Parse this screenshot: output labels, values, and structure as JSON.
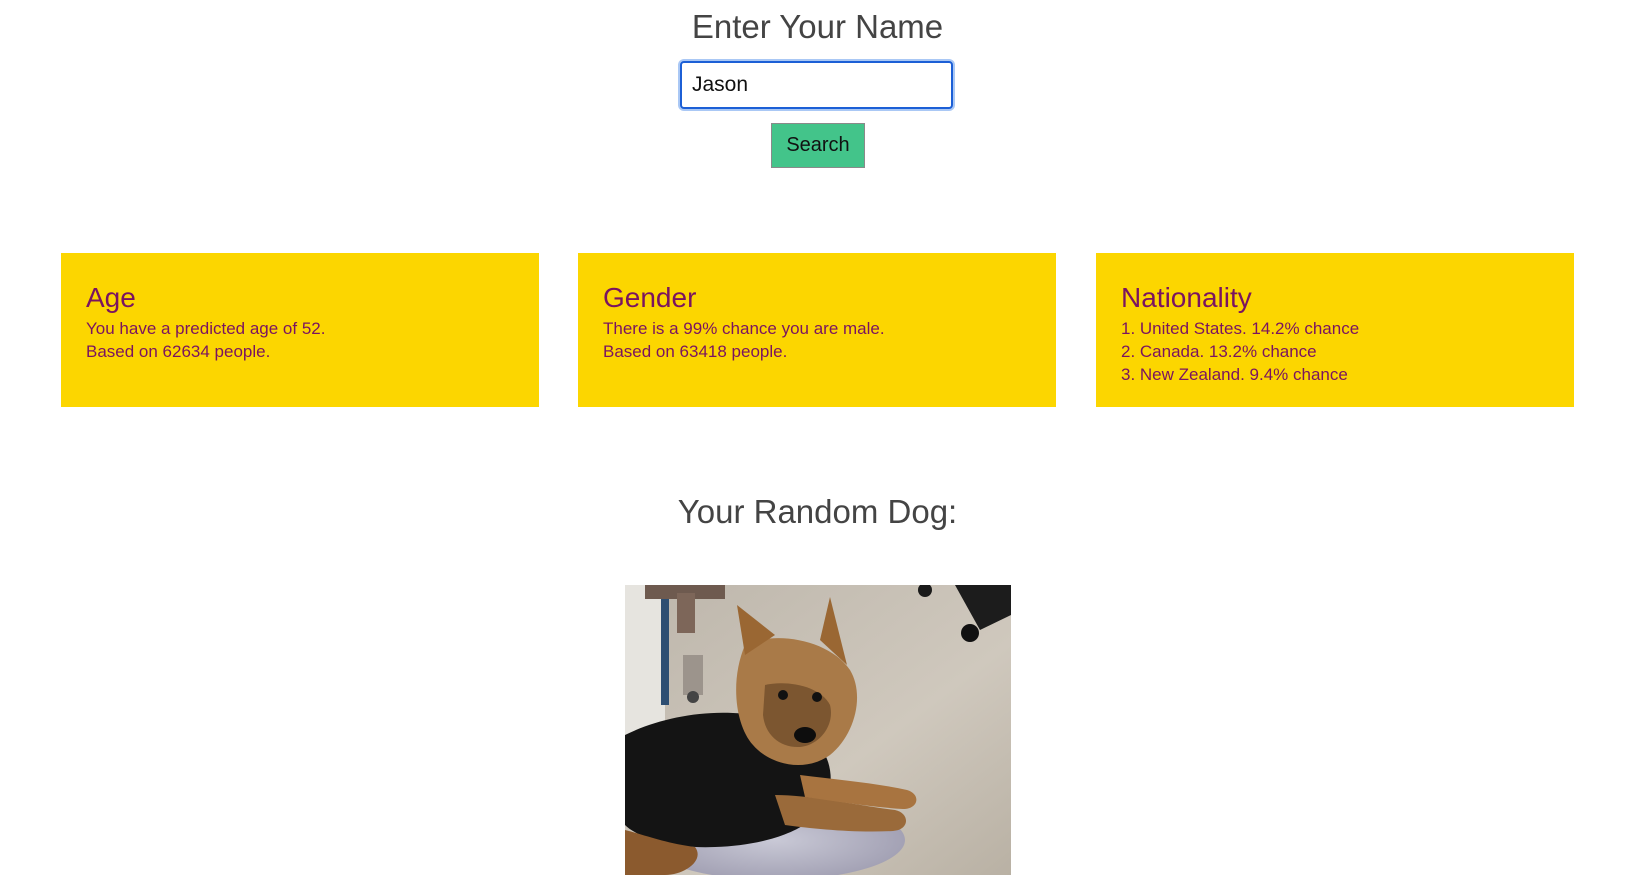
{
  "header": {
    "title": "Enter Your Name"
  },
  "search": {
    "input_value": "Jason",
    "button_label": "Search"
  },
  "cards": {
    "age": {
      "heading": "Age",
      "line1": "You have a predicted age of 52.",
      "line2": "Based on 62634 people."
    },
    "gender": {
      "heading": "Gender",
      "line1": "There is a 99% chance you are male.",
      "line2": "Based on 63418 people."
    },
    "nationality": {
      "heading": "Nationality",
      "line1": "1. United States. 14.2% chance",
      "line2": "2. Canada. 13.2% chance",
      "line3": "3. New Zealand. 9.4% chance"
    }
  },
  "dog": {
    "title": "Your Random Dog:",
    "image_icon": "dog-photo"
  },
  "colors": {
    "card_background": "#fcd600",
    "card_text": "#7a1460",
    "button_background": "#43c48a",
    "heading_text": "#444444",
    "input_border": "#1c5fd6"
  }
}
